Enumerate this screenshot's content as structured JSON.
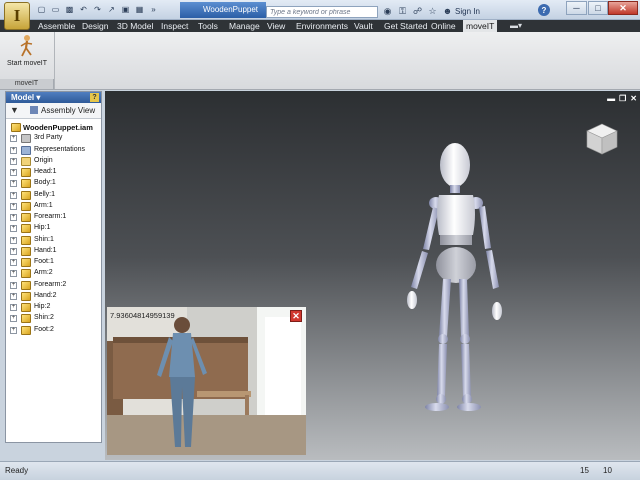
{
  "titlebar": {
    "document_title": "WoodenPuppet",
    "search_placeholder": "Type a keyword or phrase",
    "sign_in": "Sign In",
    "help": "?"
  },
  "ribbon": {
    "tabs": [
      "Assemble",
      "Design",
      "3D Model",
      "Inspect",
      "Tools",
      "Manage",
      "View",
      "Environments",
      "Vault",
      "Get Started",
      "Online",
      "moveIT"
    ],
    "active_tab": "moveIT",
    "panel_button": "Start moveIT",
    "panel_label": "moveIT"
  },
  "browser": {
    "header": "Model ▾",
    "help": "?",
    "view_label": "Assembly View",
    "root": "WoodenPuppet.iam",
    "items": [
      {
        "label": "3rd Party",
        "type": "third"
      },
      {
        "label": "Representations",
        "type": "rep"
      },
      {
        "label": "Origin",
        "type": "folder"
      },
      {
        "label": "Head:1",
        "type": "part"
      },
      {
        "label": "Body:1",
        "type": "part"
      },
      {
        "label": "Belly:1",
        "type": "part"
      },
      {
        "label": "Arm:1",
        "type": "part"
      },
      {
        "label": "Forearm:1",
        "type": "part"
      },
      {
        "label": "Hip:1",
        "type": "part"
      },
      {
        "label": "Shin:1",
        "type": "part"
      },
      {
        "label": "Hand:1",
        "type": "part"
      },
      {
        "label": "Foot:1",
        "type": "part"
      },
      {
        "label": "Arm:2",
        "type": "part"
      },
      {
        "label": "Forearm:2",
        "type": "part"
      },
      {
        "label": "Hand:2",
        "type": "part"
      },
      {
        "label": "Hip:2",
        "type": "part"
      },
      {
        "label": "Shin:2",
        "type": "part"
      },
      {
        "label": "Foot:2",
        "type": "part"
      }
    ]
  },
  "webcam": {
    "value": "7.93604814959139"
  },
  "status": {
    "text": "Ready",
    "count_a": "15",
    "count_b": "10"
  },
  "colors": {
    "ribbon_tab_bg": "#2f3337",
    "browser_header": "#3a66a8",
    "close_red": "#d1372f",
    "puppet": "#e9eaee"
  }
}
